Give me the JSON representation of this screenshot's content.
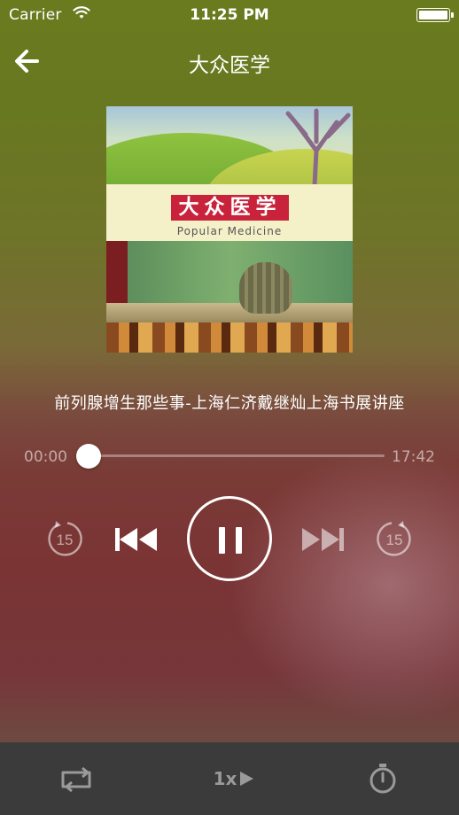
{
  "status_bar": {
    "carrier": "Carrier",
    "time": "11:25 PM",
    "wifi_icon": "wifi-icon",
    "battery_icon": "battery-full-icon"
  },
  "nav": {
    "back_icon": "arrow-left-icon",
    "title": "大众医学"
  },
  "cover": {
    "logo_text": "大众医学",
    "logo_subtitle": "Popular Medicine"
  },
  "track": {
    "title": "前列腺增生那些事-上海仁济戴继灿上海书展讲座",
    "elapsed": "00:00",
    "duration": "17:42",
    "progress_fraction": 0.0
  },
  "controls": {
    "skip_back_label": "15",
    "skip_forward_label": "15",
    "skip_back_icon": "rewind-15-icon",
    "previous_icon": "previous-track-icon",
    "pause_icon": "pause-icon",
    "next_icon": "next-track-icon",
    "skip_forward_icon": "forward-15-icon"
  },
  "bottom_bar": {
    "repeat_icon": "repeat-icon",
    "speed_label": "1x",
    "speed_icon": "play-triangle-icon",
    "timer_icon": "stopwatch-icon"
  },
  "colors": {
    "accent": "#ffffff",
    "bottom_bar_bg": "#3b3b3b",
    "logo_red": "#c8233b",
    "disabled_icon": "#9a9a9a"
  }
}
